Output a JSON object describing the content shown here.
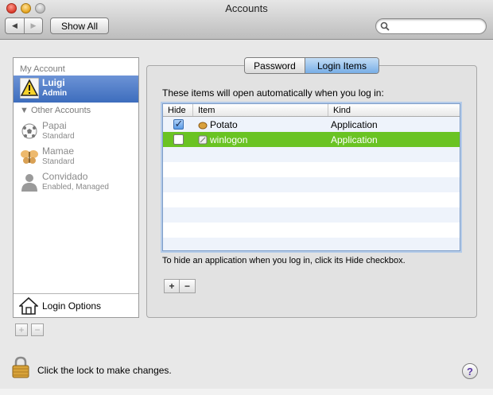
{
  "window": {
    "title": "Accounts"
  },
  "toolbar": {
    "back_label": "◀",
    "forward_label": "▶",
    "show_all_label": "Show All",
    "search_placeholder": ""
  },
  "sidebar": {
    "my_account_header": "My Account",
    "current_account": {
      "name": "Luigi",
      "role": "Admin",
      "icon": "warning-icon"
    },
    "other_accounts_header": "Other Accounts",
    "other_accounts": [
      {
        "name": "Papai",
        "role": "Standard",
        "icon": "soccer-ball-icon"
      },
      {
        "name": "Mamae",
        "role": "Standard",
        "icon": "butterfly-icon"
      },
      {
        "name": "Convidado",
        "role": "Enabled, Managed",
        "icon": "person-silhouette-icon"
      }
    ],
    "login_options_label": "Login Options",
    "add_label": "+",
    "remove_label": "−"
  },
  "tabs": [
    {
      "label": "Password",
      "selected": false
    },
    {
      "label": "Login Items",
      "selected": true
    }
  ],
  "login_items": {
    "intro": "These items will open automatically when you log in:",
    "columns": {
      "hide": "Hide",
      "item": "Item",
      "kind": "Kind"
    },
    "rows": [
      {
        "hide": true,
        "item": "Potato",
        "kind": "Application",
        "icon": "potato-icon",
        "selected": false
      },
      {
        "hide": false,
        "item": "winlogon",
        "kind": "Application",
        "icon": "app-icon",
        "selected": true
      }
    ],
    "hint": "To hide an application when you log in, click its Hide checkbox.",
    "add_label": "+",
    "remove_label": "−"
  },
  "footer": {
    "lock_text": "Click the lock to make changes.",
    "help_label": "?"
  },
  "colors": {
    "selection_blue": "#3d6dbd",
    "selected_row_green": "#6ac323",
    "tab_selected": "#78aee6"
  }
}
